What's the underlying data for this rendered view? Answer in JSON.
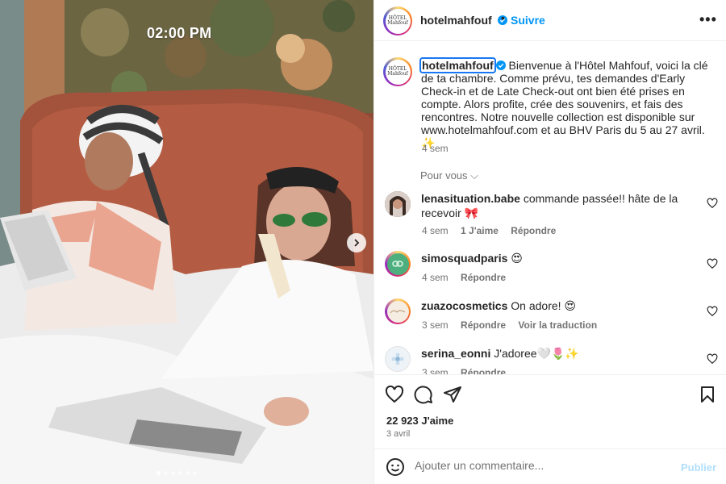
{
  "photo": {
    "timestamp": "02:00 PM",
    "carousel_dots": [
      true,
      false,
      false,
      false,
      false,
      false
    ]
  },
  "header": {
    "username": "hotelmahfouf",
    "separator": "•",
    "follow_label": "Suivre",
    "more_label": "•••",
    "avatar_text": "HÔTEL Mahfouf"
  },
  "caption": {
    "username": "hotelmahfouf",
    "text": "Bienvenue à l'Hôtel Mahfouf, voici la clé de ta chambre. Comme prévu, tes demandes d'Early Check-in et de Late Check-out ont bien été prises en compte. Alors profite, crée des souvenirs, et fais des rencontres. Notre nouvelle collection est disponible sur www.hotelmahfouf.com et au BHV Paris du 5 au 27 avril. ✨",
    "time": "4 sem"
  },
  "pour_vous": "Pour vous ⌵",
  "comments": [
    {
      "username": "lenasituation.babe",
      "text": "commande passée!! hâte de la recevoir 🎀",
      "time": "4 sem",
      "likes": "1 J'aime",
      "reply": "Répondre",
      "translate": ""
    },
    {
      "username": "simosquadparis",
      "text": "😍",
      "time": "4 sem",
      "likes": "",
      "reply": "Répondre",
      "translate": ""
    },
    {
      "username": "zuazocosmetics",
      "text": "On adore! 😍",
      "time": "3 sem",
      "likes": "",
      "reply": "Répondre",
      "translate": "Voir la traduction"
    },
    {
      "username": "serina_eonni",
      "text": "J'adoree🤍🌷✨",
      "time": "3 sem",
      "likes": "",
      "reply": "Répondre",
      "translate": ""
    }
  ],
  "actions": {
    "likes": "22 923 J'aime",
    "date": "3 avril"
  },
  "composer": {
    "placeholder": "Ajouter un commentaire...",
    "publish_label": "Publier"
  },
  "colors": {
    "accent": "#0095f6",
    "verified": "#0095f6",
    "muted": "#737373",
    "publish_disabled": "#b2dffc"
  }
}
